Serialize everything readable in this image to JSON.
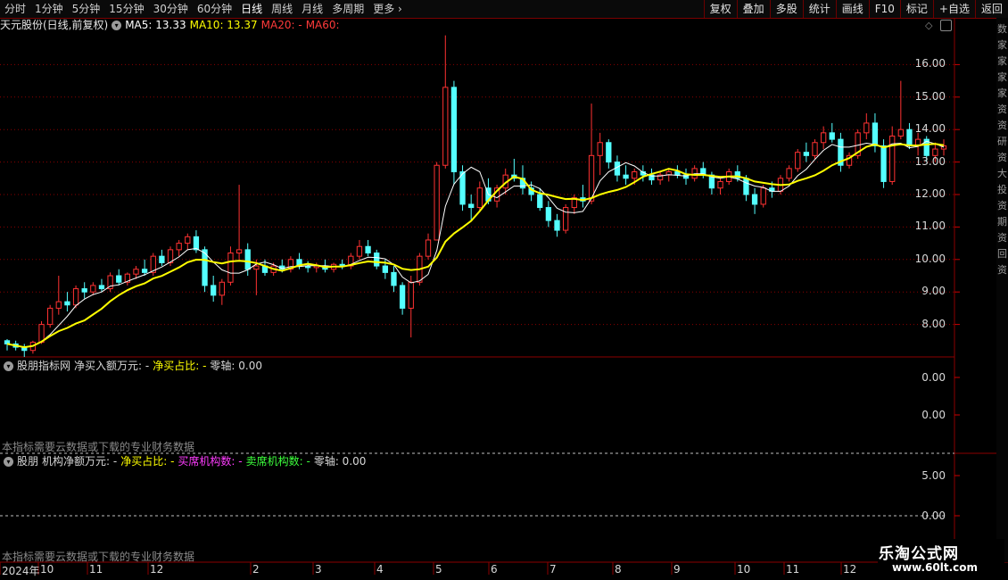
{
  "toolbar": {
    "tabs": [
      "分时",
      "1分钟",
      "5分钟",
      "15分钟",
      "30分钟",
      "60分钟",
      "日线",
      "周线",
      "月线",
      "多周期",
      "更多 ›"
    ],
    "active_tab": "日线",
    "tools": [
      "复权",
      "叠加",
      "多股",
      "统计",
      "画线",
      "F10",
      "标记",
      "+自选",
      "返回"
    ]
  },
  "main": {
    "stock_name": "天元股份(日线,前复权)",
    "ma5": "MA5: 13.33",
    "ma10": "MA10: 13.37",
    "ma20": "MA20: -",
    "ma60": "MA60:",
    "y_ticks": [
      "16.00",
      "15.00",
      "14.00",
      "13.00",
      "12.00",
      "11.00",
      "10.00",
      "9.00",
      "8.00"
    ]
  },
  "panel2": {
    "name": "股朋指标网",
    "f1": "净买入额万元: -",
    "f2": "净买占比: -",
    "f3": "零轴: 0.00",
    "y_ticks": [
      "0.00",
      "0.00"
    ],
    "note": "本指标需要云数据或下载的专业财务数据"
  },
  "panel3": {
    "name": "股朋",
    "f1": "机构净额万元: -",
    "f2": "净买占比: -",
    "f3": "买席机构数: -",
    "f4": "卖席机构数: -",
    "f5": "零轴: 0.00",
    "y_ticks": [
      "5.00",
      "0.00"
    ],
    "note": "本指标需要云数据或下载的专业财务数据"
  },
  "dates": [
    "2024年",
    "10",
    "11",
    "12",
    "2",
    "3",
    "4",
    "5",
    "6",
    "7",
    "8",
    "9",
    "10",
    "11",
    "12"
  ],
  "sidebar_chars": [
    "数",
    "家",
    "家",
    "家",
    "家",
    "资",
    "资",
    "研",
    "资",
    "大",
    "投",
    "资",
    "期",
    "资",
    "回",
    "资"
  ],
  "watermark": {
    "title": "乐淘公式网",
    "url": "www.60lt.com"
  },
  "colors": {
    "up": "#ff3232",
    "down": "#54ffff",
    "ma5": "#ffffff",
    "ma10": "#ffff00",
    "ma20": "#ff3a3a",
    "ma60": "#ff3a3a",
    "grid": "#8b0000"
  },
  "chart_data": {
    "type": "candlestick",
    "ylim": [
      7.0,
      17.0
    ],
    "candles": [
      [
        7.5,
        7.55,
        7.2,
        7.4
      ],
      [
        7.4,
        7.5,
        7.2,
        7.3
      ],
      [
        7.3,
        7.4,
        7.0,
        7.2
      ],
      [
        7.2,
        7.5,
        7.1,
        7.45
      ],
      [
        7.45,
        8.1,
        7.4,
        8.0
      ],
      [
        8.0,
        8.6,
        7.9,
        8.5
      ],
      [
        8.5,
        9.5,
        8.3,
        8.7
      ],
      [
        8.7,
        9.0,
        8.4,
        8.6
      ],
      [
        8.6,
        9.2,
        8.5,
        9.1
      ],
      [
        9.1,
        9.3,
        8.8,
        9.0
      ],
      [
        9.0,
        9.3,
        8.9,
        9.2
      ],
      [
        9.2,
        9.4,
        9.0,
        9.1
      ],
      [
        9.1,
        9.6,
        9.0,
        9.5
      ],
      [
        9.5,
        9.7,
        9.2,
        9.3
      ],
      [
        9.3,
        9.6,
        9.2,
        9.55
      ],
      [
        9.55,
        9.8,
        9.4,
        9.7
      ],
      [
        9.7,
        10.0,
        9.5,
        9.6
      ],
      [
        9.6,
        10.2,
        9.5,
        10.1
      ],
      [
        10.1,
        10.3,
        9.8,
        9.9
      ],
      [
        9.9,
        10.4,
        9.8,
        10.3
      ],
      [
        10.3,
        10.6,
        10.1,
        10.5
      ],
      [
        10.5,
        10.8,
        10.3,
        10.7
      ],
      [
        10.7,
        10.9,
        10.2,
        10.3
      ],
      [
        10.3,
        10.4,
        9.0,
        9.2
      ],
      [
        9.2,
        9.5,
        8.7,
        8.9
      ],
      [
        8.9,
        9.4,
        8.6,
        9.3
      ],
      [
        9.3,
        10.4,
        9.2,
        10.2
      ],
      [
        10.2,
        12.3,
        10.0,
        10.3
      ],
      [
        10.3,
        10.5,
        9.5,
        9.7
      ],
      [
        9.7,
        10.0,
        8.9,
        9.8
      ],
      [
        9.8,
        10.0,
        9.5,
        9.6
      ],
      [
        9.6,
        9.9,
        9.5,
        9.8
      ],
      [
        9.8,
        10.0,
        9.6,
        9.7
      ],
      [
        9.7,
        10.1,
        9.6,
        10.0
      ],
      [
        10.0,
        10.2,
        9.7,
        9.8
      ],
      [
        9.8,
        9.95,
        9.6,
        9.75
      ],
      [
        9.75,
        9.9,
        9.6,
        9.8
      ],
      [
        9.8,
        10.0,
        9.6,
        9.7
      ],
      [
        9.7,
        9.9,
        9.6,
        9.85
      ],
      [
        9.85,
        10.0,
        9.7,
        9.8
      ],
      [
        9.8,
        10.2,
        9.7,
        10.1
      ],
      [
        10.1,
        10.6,
        10.0,
        10.4
      ],
      [
        10.4,
        10.6,
        10.1,
        10.2
      ],
      [
        10.2,
        10.3,
        9.7,
        9.8
      ],
      [
        9.8,
        10.0,
        9.4,
        9.6
      ],
      [
        9.6,
        9.8,
        9.0,
        9.2
      ],
      [
        9.2,
        9.3,
        8.3,
        8.5
      ],
      [
        8.5,
        9.5,
        7.6,
        9.3
      ],
      [
        9.3,
        10.2,
        9.2,
        10.1
      ],
      [
        10.1,
        10.8,
        10.0,
        10.6
      ],
      [
        10.6,
        13.0,
        10.6,
        12.9
      ],
      [
        12.9,
        16.9,
        12.8,
        15.3
      ],
      [
        15.3,
        15.5,
        12.3,
        12.7
      ],
      [
        12.7,
        12.9,
        11.5,
        11.7
      ],
      [
        11.7,
        12.0,
        11.2,
        11.6
      ],
      [
        11.6,
        12.4,
        11.5,
        12.2
      ],
      [
        12.2,
        12.5,
        11.7,
        11.8
      ],
      [
        11.8,
        12.3,
        11.6,
        12.2
      ],
      [
        12.2,
        12.8,
        12.0,
        12.6
      ],
      [
        12.6,
        13.1,
        12.4,
        12.5
      ],
      [
        12.5,
        12.9,
        12.0,
        12.2
      ],
      [
        12.2,
        12.4,
        11.8,
        12.0
      ],
      [
        12.0,
        12.2,
        11.5,
        11.6
      ],
      [
        11.6,
        11.8,
        11.0,
        11.2
      ],
      [
        11.2,
        11.4,
        10.7,
        10.9
      ],
      [
        10.9,
        11.7,
        10.8,
        11.6
      ],
      [
        11.6,
        12.0,
        11.4,
        11.9
      ],
      [
        11.9,
        12.3,
        11.6,
        11.8
      ],
      [
        11.8,
        14.8,
        11.7,
        13.2
      ],
      [
        13.2,
        13.9,
        12.6,
        13.6
      ],
      [
        13.6,
        13.7,
        12.8,
        13.0
      ],
      [
        13.0,
        13.2,
        12.4,
        12.6
      ],
      [
        12.6,
        12.9,
        12.3,
        12.5
      ],
      [
        12.5,
        12.8,
        12.3,
        12.7
      ],
      [
        12.7,
        12.9,
        12.4,
        12.6
      ],
      [
        12.6,
        12.8,
        12.3,
        12.45
      ],
      [
        12.45,
        12.7,
        12.3,
        12.6
      ],
      [
        12.6,
        12.8,
        12.4,
        12.7
      ],
      [
        12.7,
        12.9,
        12.5,
        12.6
      ],
      [
        12.6,
        12.8,
        12.3,
        12.5
      ],
      [
        12.5,
        12.9,
        12.4,
        12.8
      ],
      [
        12.8,
        13.0,
        12.5,
        12.6
      ],
      [
        12.6,
        12.7,
        12.0,
        12.2
      ],
      [
        12.2,
        12.5,
        12.0,
        12.4
      ],
      [
        12.4,
        12.8,
        12.3,
        12.7
      ],
      [
        12.7,
        12.9,
        12.4,
        12.5
      ],
      [
        12.5,
        12.6,
        11.8,
        12.0
      ],
      [
        12.0,
        12.2,
        11.4,
        11.7
      ],
      [
        11.7,
        12.3,
        11.6,
        12.2
      ],
      [
        12.2,
        12.4,
        11.9,
        12.1
      ],
      [
        12.1,
        12.6,
        12.0,
        12.5
      ],
      [
        12.5,
        12.9,
        12.4,
        12.8
      ],
      [
        12.8,
        13.4,
        12.7,
        13.3
      ],
      [
        13.3,
        13.6,
        13.0,
        13.2
      ],
      [
        13.2,
        13.7,
        13.1,
        13.6
      ],
      [
        13.6,
        14.1,
        13.4,
        13.9
      ],
      [
        13.9,
        14.2,
        13.6,
        13.7
      ],
      [
        13.7,
        13.9,
        12.7,
        12.9
      ],
      [
        12.9,
        13.3,
        12.8,
        13.2
      ],
      [
        13.2,
        14.0,
        13.1,
        13.9
      ],
      [
        13.9,
        14.5,
        13.7,
        14.2
      ],
      [
        14.2,
        14.5,
        13.3,
        13.5
      ],
      [
        13.5,
        13.7,
        12.2,
        12.4
      ],
      [
        12.4,
        14.1,
        12.3,
        13.8
      ],
      [
        13.8,
        15.5,
        13.7,
        14.0
      ],
      [
        14.0,
        14.2,
        13.4,
        13.5
      ],
      [
        13.5,
        13.9,
        13.2,
        13.7
      ],
      [
        13.7,
        13.8,
        13.0,
        13.2
      ],
      [
        13.2,
        13.6,
        13.0,
        13.4
      ],
      [
        13.4,
        13.7,
        13.2,
        13.5
      ]
    ]
  }
}
